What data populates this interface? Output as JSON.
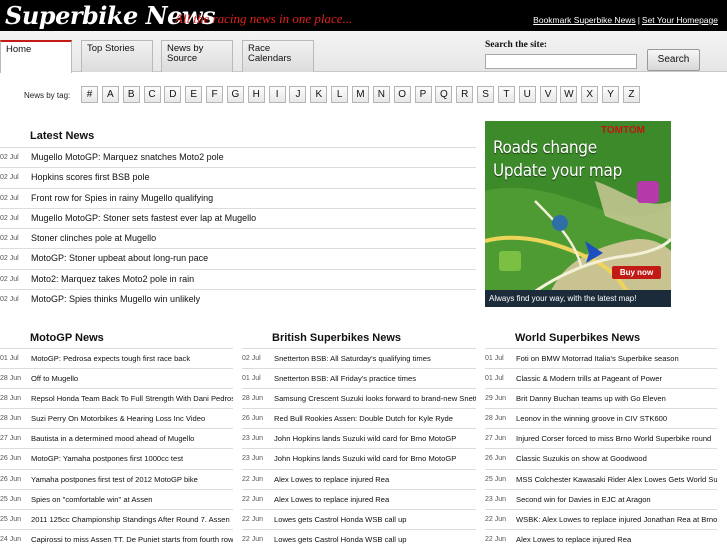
{
  "header": {
    "logo": "Superbike News",
    "tagline": "All the racing news in one place...",
    "links": [
      "Bookmark Superbike News",
      "Set Your Homepage"
    ],
    "link_separator": "|"
  },
  "tabs": [
    {
      "label": "Home",
      "active": true
    },
    {
      "label": "Top Stories",
      "active": false
    },
    {
      "label": "News by Source",
      "active": false
    },
    {
      "label": "Race Calendars",
      "active": false
    }
  ],
  "search": {
    "label": "Search the site:",
    "value": "",
    "button": "Search"
  },
  "tags": {
    "label": "News by tag:",
    "letters": [
      "#",
      "A",
      "B",
      "C",
      "D",
      "E",
      "F",
      "G",
      "H",
      "I",
      "J",
      "K",
      "L",
      "M",
      "N",
      "O",
      "P",
      "Q",
      "R",
      "S",
      "T",
      "U",
      "V",
      "W",
      "X",
      "Y",
      "Z"
    ]
  },
  "latest": {
    "title": "Latest News",
    "items": [
      {
        "date": "02 Jul",
        "title": "Mugello MotoGP: Marquez snatches Moto2 pole"
      },
      {
        "date": "02 Jul",
        "title": "Hopkins scores first BSB pole"
      },
      {
        "date": "02 Jul",
        "title": "Front row for Spies in rainy Mugello qualifying"
      },
      {
        "date": "02 Jul",
        "title": "Mugello MotoGP: Stoner sets fastest ever lap at Mugello"
      },
      {
        "date": "02 Jul",
        "title": "Stoner clinches pole at Mugello"
      },
      {
        "date": "02 Jul",
        "title": "MotoGP: Stoner upbeat about long-run pace"
      },
      {
        "date": "02 Jul",
        "title": "Moto2: Marquez takes Moto2 pole in rain"
      },
      {
        "date": "02 Jul",
        "title": "MotoGP: Spies thinks Mugello win unlikely"
      }
    ]
  },
  "ad": {
    "brand": "TOMTOM",
    "headline1": "Roads change",
    "headline2": "Update your map",
    "button": "Buy now",
    "footer": "Always find your way, with the latest map!"
  },
  "motogp": {
    "title": "MotoGP News",
    "items": [
      {
        "date": "01 Jul",
        "title": "MotoGP: Pedrosa expects tough first race back"
      },
      {
        "date": "28 Jun",
        "title": "Off to Mugello"
      },
      {
        "date": "28 Jun",
        "title": "Repsol Honda Team Back To Full Strength With Dani Pedrosa"
      },
      {
        "date": "28 Jun",
        "title": "Suzi Perry On Motorbikes & Hearing Loss Inc Video"
      },
      {
        "date": "27 Jun",
        "title": "Bautista in a determined mood ahead of Mugello"
      },
      {
        "date": "26 Jun",
        "title": "MotoGP: Yamaha postpones first 1000cc test"
      },
      {
        "date": "26 Jun",
        "title": "Yamaha postpones first test of 2012 MotoGP bike"
      },
      {
        "date": "25 Jun",
        "title": "Spies on \"comfortable win\" at Assen"
      },
      {
        "date": "25 Jun",
        "title": "2011 125cc Championship Standings After Round 7. Assen"
      },
      {
        "date": "24 Jun",
        "title": "Capirossi to miss Assen TT. De Puniet starts from fourth row"
      }
    ]
  },
  "bsb": {
    "title": "British Superbikes News",
    "items": [
      {
        "date": "02 Jul",
        "title": "Snetterton BSB: All Saturday's qualifying times"
      },
      {
        "date": "01 Jul",
        "title": "Snetterton BSB: All Friday's practice times"
      },
      {
        "date": "28 Jun",
        "title": "Samsung Crescent Suzuki looks forward to brand-new Snetterton"
      },
      {
        "date": "26 Jun",
        "title": "Red Bull Rookies Assen: Double Dutch for Kyle Ryde"
      },
      {
        "date": "23 Jun",
        "title": "John Hopkins lands Suzuki wild card for Brno MotoGP"
      },
      {
        "date": "23 Jun",
        "title": "John Hopkins lands Suzuki wild card for Brno MotoGP"
      },
      {
        "date": "22 Jun",
        "title": "Alex Lowes to replace injured Rea"
      },
      {
        "date": "22 Jun",
        "title": "Alex Lowes to replace injured Rea"
      },
      {
        "date": "22 Jun",
        "title": "Lowes gets Castrol Honda WSB call up"
      },
      {
        "date": "22 Jun",
        "title": "Lowes gets Castrol Honda WSB call up"
      }
    ]
  },
  "wsb": {
    "title": "World Superbikes News",
    "items": [
      {
        "date": "01 Jul",
        "title": "Foti on BMW Motorrad Italia's Superbike season"
      },
      {
        "date": "01 Jul",
        "title": "Classic & Modern trills at Pageant of Power"
      },
      {
        "date": "29 Jun",
        "title": "Brit Danny Buchan teams up with Go Eleven"
      },
      {
        "date": "28 Jun",
        "title": "Leonov in the winning groove in CIV STK600"
      },
      {
        "date": "27 Jun",
        "title": "Injured Corser forced to miss Brno World Superbike round"
      },
      {
        "date": "26 Jun",
        "title": "Classic Suzukis on show at Goodwood"
      },
      {
        "date": "25 Jun",
        "title": "MSS Colchester Kawasaki Rider Alex Lowes Gets World Superbike ride"
      },
      {
        "date": "23 Jun",
        "title": "Second win for Davies in EJC at Aragon"
      },
      {
        "date": "22 Jun",
        "title": "WSBK: Alex Lowes to replace injured Jonathan Rea at Brno"
      },
      {
        "date": "22 Jun",
        "title": "Alex Lowes to replace injured Rea"
      }
    ]
  }
}
